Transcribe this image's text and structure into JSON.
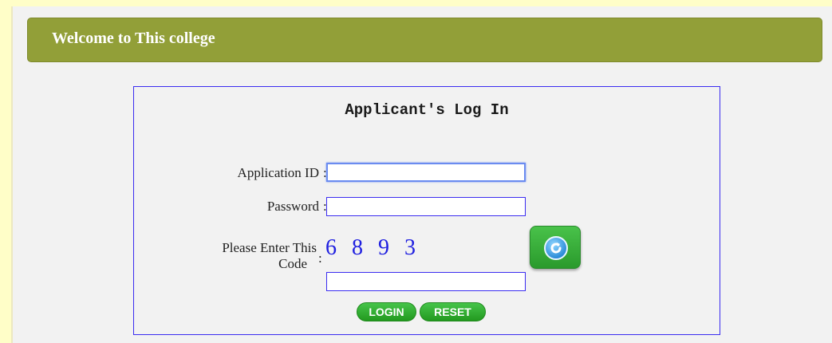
{
  "header": {
    "title": "Welcome to This college"
  },
  "login": {
    "heading": "Applicant's Log In",
    "application_id_label": "Application ID",
    "application_id_value": "",
    "password_label": "Password",
    "password_value": "",
    "captcha_label_line1": "Please Enter This",
    "captcha_label_line2": "Code",
    "captcha_code": "6 8 9 3",
    "captcha_value": "",
    "colon": ":",
    "login_button": "LOGIN",
    "reset_button": "RESET",
    "refresh_icon": "refresh-icon"
  },
  "colors": {
    "header_bg": "#929f38",
    "box_border": "#3a2cf0",
    "captcha_text": "#2020e0",
    "button_green": "#2fae2f"
  }
}
